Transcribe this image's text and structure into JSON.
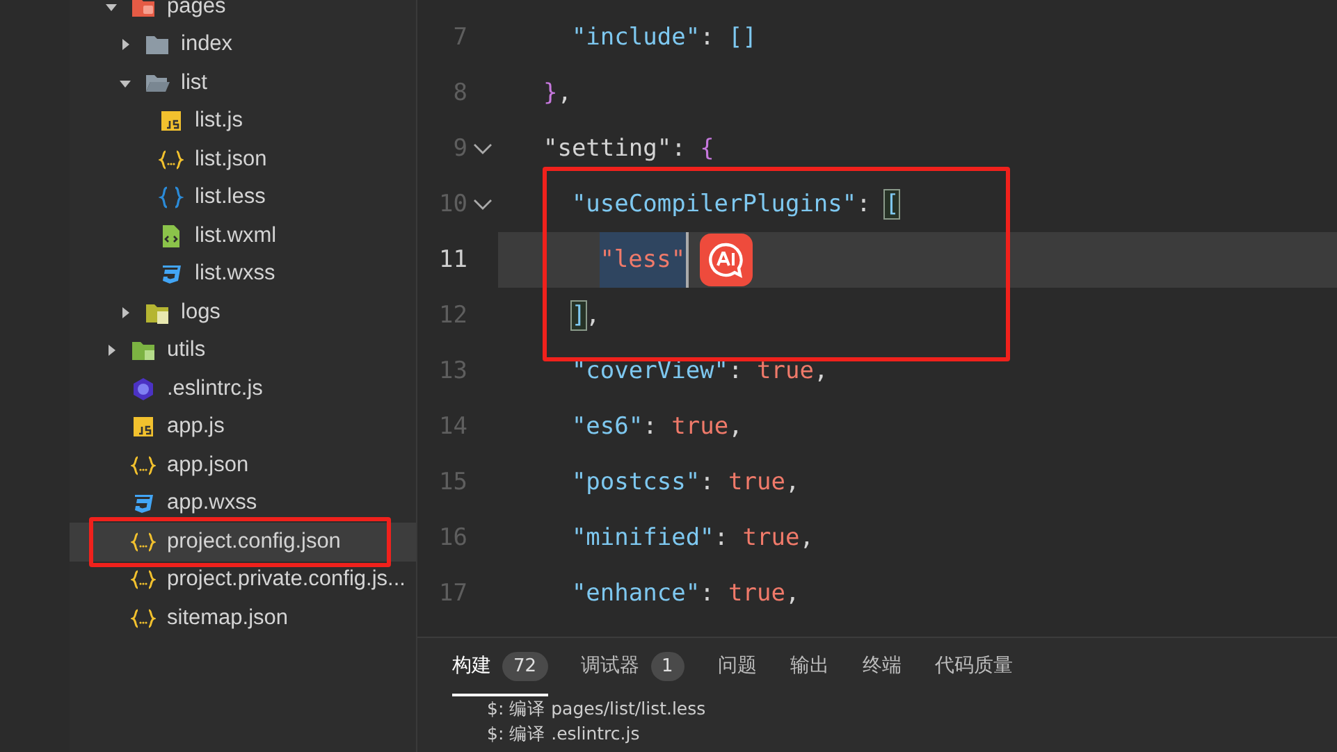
{
  "file_tree": [
    {
      "name": "pages",
      "kind": "folder-pages",
      "expanded": true,
      "selected": false,
      "highlighted": false,
      "children": [
        {
          "name": "index",
          "kind": "folder",
          "expanded": false,
          "selected": false,
          "highlighted": false
        },
        {
          "name": "list",
          "kind": "folder-open",
          "expanded": true,
          "selected": false,
          "highlighted": false,
          "children": [
            {
              "name": "list.js",
              "kind": "js",
              "selected": false,
              "highlighted": false
            },
            {
              "name": "list.json",
              "kind": "json",
              "selected": false,
              "highlighted": false
            },
            {
              "name": "list.less",
              "kind": "less",
              "selected": false,
              "highlighted": false
            },
            {
              "name": "list.wxml",
              "kind": "wxml",
              "selected": false,
              "highlighted": false
            },
            {
              "name": "list.wxss",
              "kind": "wxss",
              "selected": false,
              "highlighted": false
            }
          ]
        },
        {
          "name": "logs",
          "kind": "folder-logs",
          "expanded": false,
          "selected": false,
          "highlighted": false
        }
      ]
    },
    {
      "name": "utils",
      "kind": "folder-utils",
      "expanded": false,
      "selected": false,
      "highlighted": false
    },
    {
      "name": ".eslintrc.js",
      "kind": "eslint",
      "selected": false,
      "highlighted": false
    },
    {
      "name": "app.js",
      "kind": "js",
      "selected": false,
      "highlighted": false
    },
    {
      "name": "app.json",
      "kind": "json",
      "selected": false,
      "highlighted": false
    },
    {
      "name": "app.wxss",
      "kind": "wxss",
      "selected": false,
      "highlighted": false
    },
    {
      "name": "project.config.json",
      "kind": "json",
      "selected": true,
      "highlighted": true
    },
    {
      "name": "project.private.config.js...",
      "kind": "json",
      "selected": false,
      "highlighted": false
    },
    {
      "name": "sitemap.json",
      "kind": "json",
      "selected": false,
      "highlighted": false
    }
  ],
  "editor": {
    "lines": [
      {
        "number": "7",
        "foldable": false,
        "current": false,
        "highlighted": false,
        "tokens": [
          {
            "kind": "key",
            "text": "    \"include\""
          },
          {
            "kind": "punct",
            "text": ": "
          },
          {
            "kind": "bracket",
            "text": "[]"
          }
        ]
      },
      {
        "number": "8",
        "foldable": false,
        "current": false,
        "highlighted": false,
        "tokens": [
          {
            "kind": "brace",
            "text": "  }"
          },
          {
            "kind": "punct",
            "text": ","
          }
        ]
      },
      {
        "number": "9",
        "foldable": true,
        "current": false,
        "highlighted": false,
        "tokens": [
          {
            "kind": "plain",
            "text": "  \"setting\""
          },
          {
            "kind": "punct",
            "text": ": "
          },
          {
            "kind": "brace",
            "text": "{"
          }
        ]
      },
      {
        "number": "10",
        "foldable": true,
        "current": false,
        "highlighted": true,
        "tokens": [
          {
            "kind": "key",
            "text": "    \"useCompilerPlugins\""
          },
          {
            "kind": "punct",
            "text": ": "
          },
          {
            "kind": "bracket-match",
            "text": "["
          }
        ]
      },
      {
        "number": "11",
        "foldable": false,
        "current": true,
        "highlighted": true,
        "tokens": [
          {
            "kind": "value-selected",
            "text": "\"less\""
          }
        ]
      },
      {
        "number": "12",
        "foldable": false,
        "current": false,
        "highlighted": true,
        "tokens": [
          {
            "kind": "bracket-match",
            "text": "]"
          },
          {
            "kind": "punct",
            "text": ","
          }
        ]
      },
      {
        "number": "13",
        "foldable": false,
        "current": false,
        "highlighted": false,
        "tokens": [
          {
            "kind": "key",
            "text": "    \"coverView\""
          },
          {
            "kind": "punct",
            "text": ": "
          },
          {
            "kind": "value",
            "text": "true"
          },
          {
            "kind": "punct",
            "text": ","
          }
        ]
      },
      {
        "number": "14",
        "foldable": false,
        "current": false,
        "highlighted": false,
        "tokens": [
          {
            "kind": "key",
            "text": "    \"es6\""
          },
          {
            "kind": "punct",
            "text": ": "
          },
          {
            "kind": "value",
            "text": "true"
          },
          {
            "kind": "punct",
            "text": ","
          }
        ]
      },
      {
        "number": "15",
        "foldable": false,
        "current": false,
        "highlighted": false,
        "tokens": [
          {
            "kind": "key",
            "text": "    \"postcss\""
          },
          {
            "kind": "punct",
            "text": ": "
          },
          {
            "kind": "value",
            "text": "true"
          },
          {
            "kind": "punct",
            "text": ","
          }
        ]
      },
      {
        "number": "16",
        "foldable": false,
        "current": false,
        "highlighted": false,
        "tokens": [
          {
            "kind": "key",
            "text": "    \"minified\""
          },
          {
            "kind": "punct",
            "text": ": "
          },
          {
            "kind": "value",
            "text": "true"
          },
          {
            "kind": "punct",
            "text": ","
          }
        ]
      },
      {
        "number": "17",
        "foldable": false,
        "current": false,
        "highlighted": false,
        "tokens": [
          {
            "kind": "key",
            "text": "    \"enhance\""
          },
          {
            "kind": "punct",
            "text": ": "
          },
          {
            "kind": "value",
            "text": "true"
          },
          {
            "kind": "punct",
            "text": ","
          }
        ]
      }
    ]
  },
  "bottom_panel": {
    "tabs": [
      {
        "label": "构建",
        "count": "72",
        "selected": true
      },
      {
        "label": "调试器",
        "count": "1",
        "selected": false
      },
      {
        "label": "问题",
        "selected": false
      },
      {
        "label": "输出",
        "selected": false
      },
      {
        "label": "终端",
        "selected": false
      },
      {
        "label": "代码质量",
        "selected": false
      }
    ],
    "output": [
      "$: 编译 pages/list/list.less",
      "$: 编译 .eslintrc.js"
    ]
  }
}
